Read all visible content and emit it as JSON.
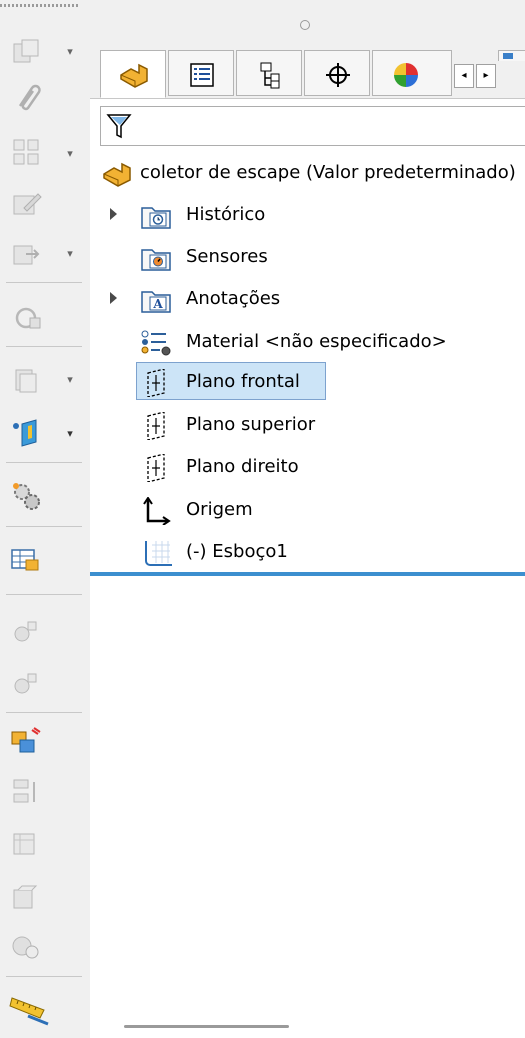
{
  "feature_tree": {
    "root_label": "coletor de escape  (Valor predeterminado)",
    "items": [
      {
        "label": "Histórico",
        "icon": "history-folder-icon",
        "expandable": true
      },
      {
        "label": "Sensores",
        "icon": "sensors-folder-icon",
        "expandable": false
      },
      {
        "label": "Anotações",
        "icon": "annotations-folder-icon",
        "expandable": true
      },
      {
        "label": "Material <não especificado>",
        "icon": "material-icon",
        "expandable": false
      },
      {
        "label": "Plano frontal",
        "icon": "plane-icon",
        "expandable": false,
        "selected": true
      },
      {
        "label": "Plano superior",
        "icon": "plane-icon",
        "expandable": false
      },
      {
        "label": "Plano direito",
        "icon": "plane-icon",
        "expandable": false
      },
      {
        "label": "Origem",
        "icon": "origin-icon",
        "expandable": false
      },
      {
        "label": "(-) Esboço1",
        "icon": "sketch-icon",
        "expandable": false
      }
    ]
  },
  "tabs": [
    {
      "name": "featuremanager-tab",
      "icon": "part-icon",
      "active": true
    },
    {
      "name": "propertymanager-tab",
      "icon": "property-list-icon"
    },
    {
      "name": "configurationmanager-tab",
      "icon": "configuration-tree-icon"
    },
    {
      "name": "dimxpertmanager-tab",
      "icon": "crosshair-icon"
    },
    {
      "name": "displaymanager-tab",
      "icon": "color-pie-icon"
    }
  ],
  "colors": {
    "selection_fill": "#cce4f7",
    "selection_border": "#7da2ce",
    "rollback_bar": "#3c8fcf",
    "part_icon": "#e8a317"
  }
}
